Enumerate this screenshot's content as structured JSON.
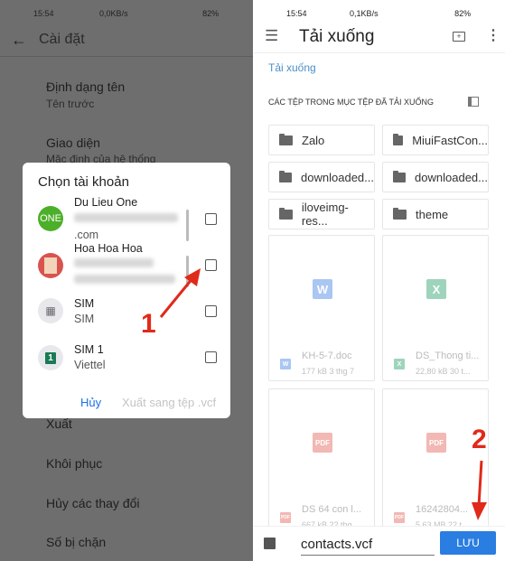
{
  "left": {
    "status_bar": {
      "time": "15:54",
      "speed": "0,0KB/s",
      "battery": "82%"
    },
    "header": {
      "title": "Cài đặt"
    },
    "settings": [
      {
        "title": "Định dạng tên",
        "subtitle": "Tên trước"
      },
      {
        "title": "Giao diện",
        "subtitle": "Mặc định của hệ thống"
      },
      {
        "title": "Xuất"
      },
      {
        "title": "Khôi phục"
      },
      {
        "title": "Hủy các thay đổi"
      },
      {
        "title": "Số bị chặn"
      }
    ],
    "dialog": {
      "title": "Chọn tài khoản",
      "accounts": [
        {
          "name": "Du Lieu One",
          "detail_suffix": ".com",
          "avatar_text": "ONE",
          "checked": false
        },
        {
          "name": "Hoa Hoa Hoa",
          "checked": false
        },
        {
          "name": "SIM",
          "detail": "SIM",
          "checked": false
        },
        {
          "name": "SIM 1",
          "detail": "Viettel",
          "avatar_text": "1",
          "checked": false
        }
      ],
      "cancel": "Hủy",
      "export": "Xuất sang tệp .vcf"
    },
    "annotation": "1"
  },
  "right": {
    "status_bar": {
      "time": "15:54",
      "speed": "0,1KB/s",
      "battery": "82%"
    },
    "header": {
      "title": "Tải xuống"
    },
    "breadcrumb": "Tải xuống",
    "section_title": "CÁC TỆP TRONG MỤC TỆP ĐÃ TẢI XUỐNG",
    "folders": [
      "Zalo",
      "MiuiFastCon...",
      "downloaded...",
      "downloaded...",
      "iloveimg-res...",
      "theme"
    ],
    "files": [
      {
        "name": "KH-5-7.doc",
        "meta": "177 kB 3 thg 7",
        "type": "W",
        "color": "#4a86e8"
      },
      {
        "name": "DS_Thong ti...",
        "meta": "22,80 kB 30 t...",
        "type": "X",
        "color": "#1e9e5e"
      },
      {
        "name": "DS 64 con l...",
        "meta": "667 kB 22 thg",
        "type": "PDF",
        "color": "#e04a3f"
      },
      {
        "name": "16242804...",
        "meta": "5,63 MB 22 t...",
        "type": "PDF",
        "color": "#e04a3f"
      }
    ],
    "filename": "contacts.vcf",
    "save": "LƯU",
    "annotation": "2"
  },
  "colors": {
    "accent": "#1a73e8",
    "annotation": "#e02a1a"
  }
}
